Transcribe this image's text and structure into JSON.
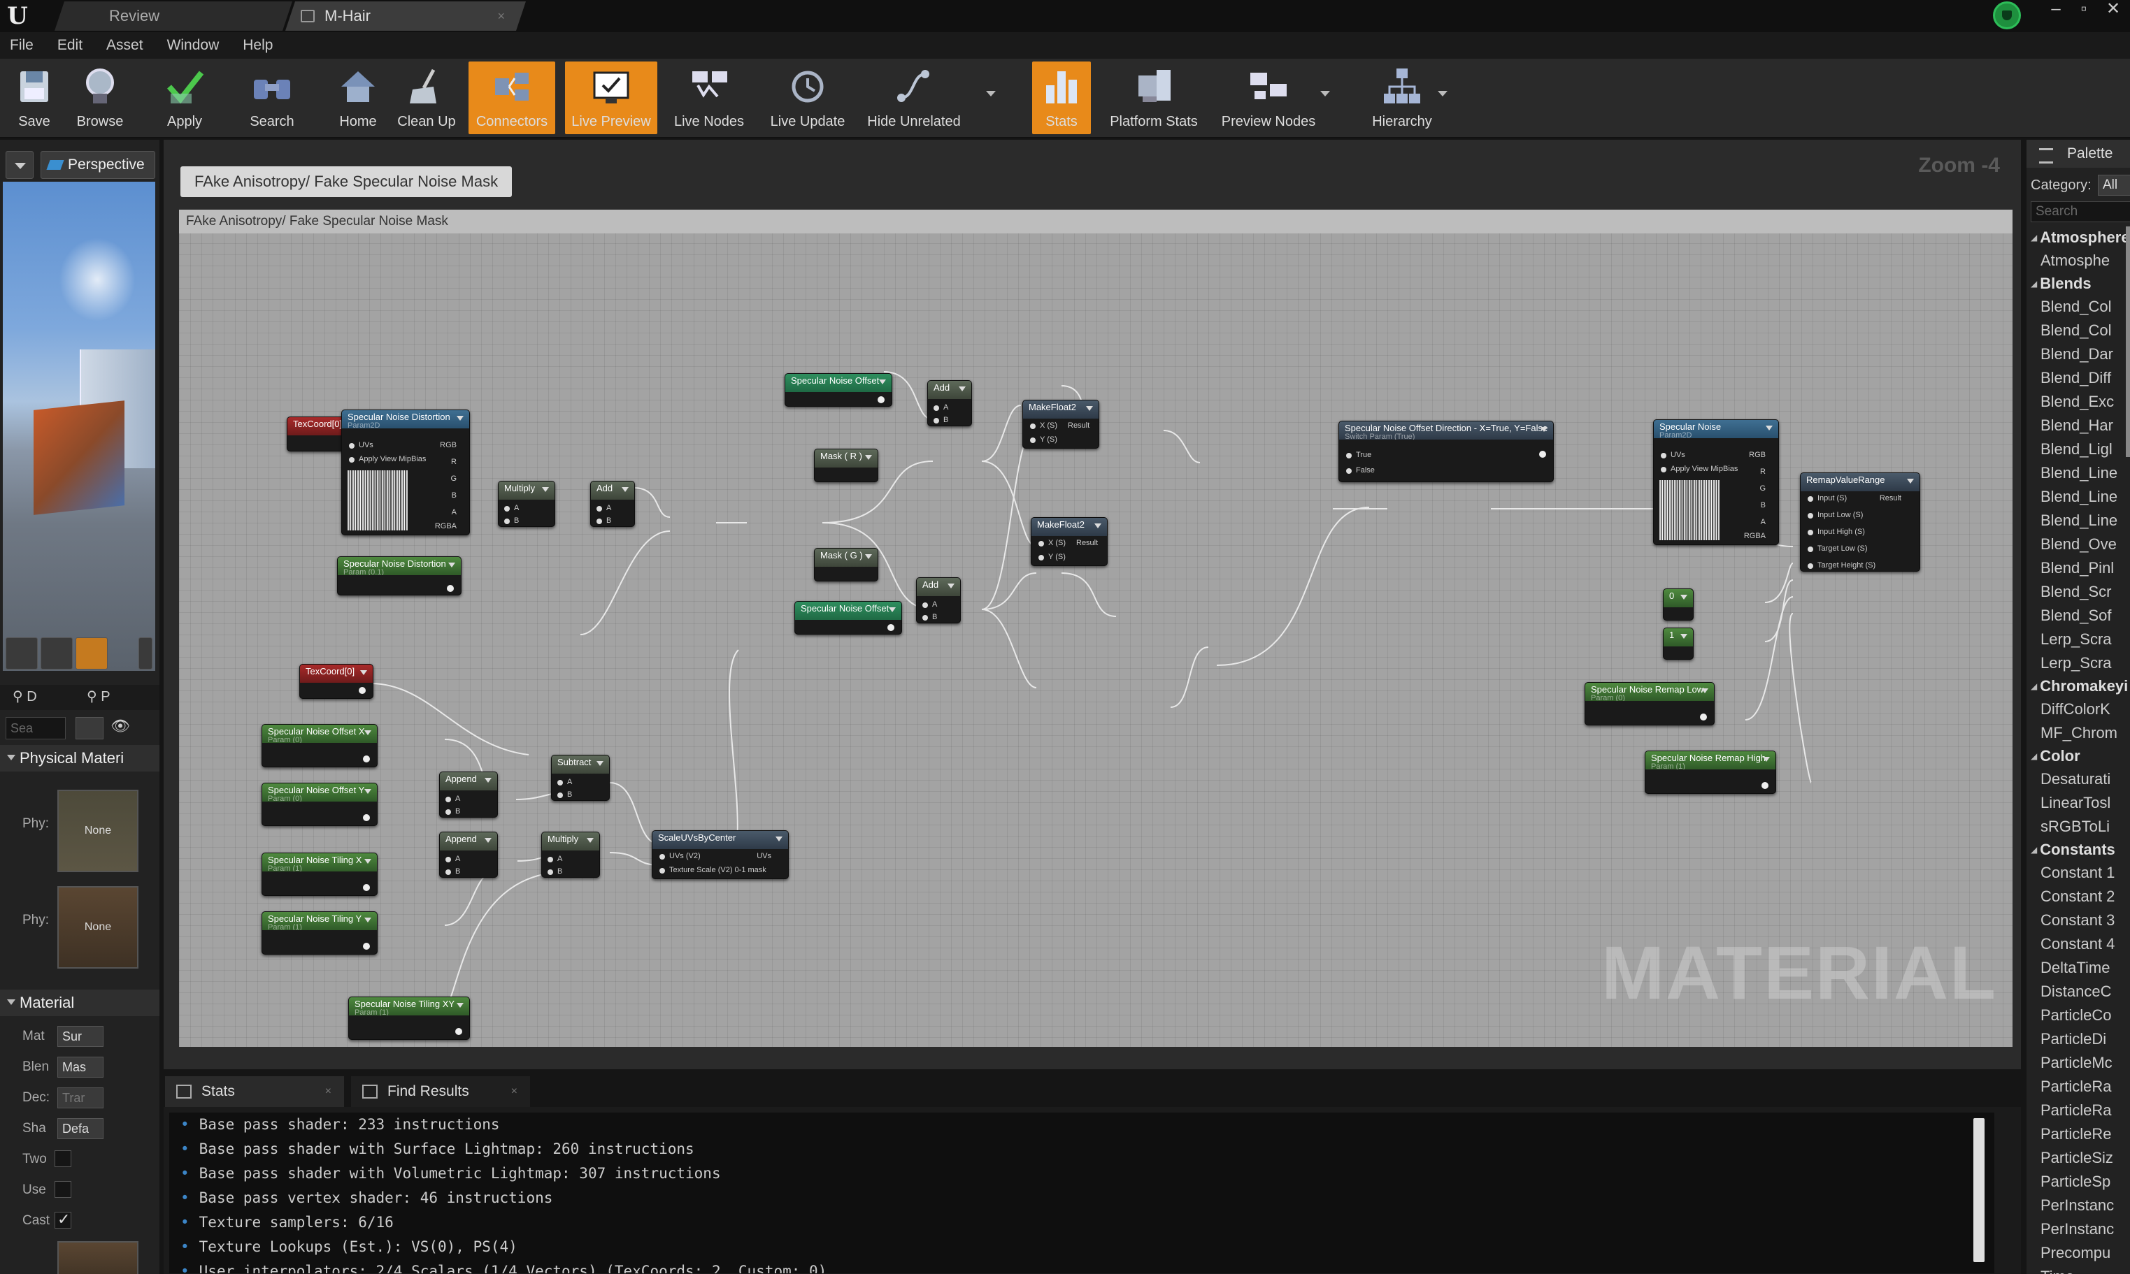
{
  "titlebar": {
    "tabs": [
      {
        "label": "Review"
      },
      {
        "label": "M-Hair"
      }
    ],
    "close_glyph": "×"
  },
  "menu": [
    "File",
    "Edit",
    "Asset",
    "Window",
    "Help"
  ],
  "toolbar": {
    "buttons": [
      {
        "label": "Save",
        "icon": "save-icon"
      },
      {
        "label": "Browse",
        "icon": "browse-icon"
      },
      {
        "label": "Apply",
        "icon": "apply-icon"
      },
      {
        "label": "Search",
        "icon": "search-icon"
      },
      {
        "label": "Home",
        "icon": "home-icon"
      },
      {
        "label": "Clean Up",
        "icon": "cleanup-icon"
      },
      {
        "label": "Connectors",
        "icon": "connectors-icon",
        "active": true
      },
      {
        "label": "Live Preview",
        "icon": "live-preview-icon",
        "active": true
      },
      {
        "label": "Live Nodes",
        "icon": "live-nodes-icon"
      },
      {
        "label": "Live Update",
        "icon": "live-update-icon"
      },
      {
        "label": "Hide Unrelated",
        "icon": "hide-unrelated-icon"
      },
      {
        "label": "Stats",
        "icon": "stats-icon",
        "active": true
      },
      {
        "label": "Platform Stats",
        "icon": "platform-stats-icon"
      },
      {
        "label": "Preview Nodes",
        "icon": "preview-nodes-icon"
      },
      {
        "label": "Hierarchy",
        "icon": "hierarchy-icon"
      }
    ]
  },
  "viewport": {
    "mode": "Perspective",
    "axis": "Z"
  },
  "details": {
    "tabs": [
      "D",
      "P"
    ],
    "search_placeholder": "Sea",
    "sections": {
      "physical": "Physical Materi",
      "material": "Material"
    },
    "phys_rows": [
      {
        "label": "Phy:",
        "value": "None"
      },
      {
        "label": "Phy:",
        "value": "None"
      }
    ],
    "material_rows": [
      {
        "label": "Mat",
        "combo": "Sur"
      },
      {
        "label": "Blen",
        "combo": "Mas"
      },
      {
        "label": "Dec:",
        "combo": "Trar"
      },
      {
        "label": "Sha",
        "combo": "Defa"
      }
    ],
    "check_rows": [
      {
        "label": "Two",
        "checked": false
      },
      {
        "label": "Use",
        "checked": false
      },
      {
        "label": "Cast",
        "checked": true
      }
    ]
  },
  "graph": {
    "title": "FAke Anisotropy/ Fake Specular Noise Mask",
    "comment": "FAke Anisotropy/ Fake Specular Noise Mask",
    "zoom": "Zoom -4",
    "watermark": "MATERIAL",
    "nodes": {
      "texcoord1": {
        "title": "TexCoord[0]"
      },
      "noise_dist": {
        "title": "Specular Noise Distortion",
        "sub": "Param2D",
        "pins": [
          "UVs",
          "Apply View MipBias"
        ],
        "outs": [
          "RGB",
          "R",
          "G",
          "B",
          "A",
          "RGBA"
        ]
      },
      "noise_dist_param": {
        "title": "Specular Noise Distortion",
        "sub": "Param (0.1)"
      },
      "multiply1": {
        "title": "Multiply",
        "pins": [
          "A",
          "B"
        ]
      },
      "add1": {
        "title": "Add",
        "pins": [
          "A",
          "B"
        ]
      },
      "noise_offset1": {
        "title": "Specular Noise Offset"
      },
      "mask_r": {
        "title": "Mask ( R )"
      },
      "mask_g": {
        "title": "Mask ( G )"
      },
      "add2": {
        "title": "Add",
        "pins": [
          "A",
          "B"
        ]
      },
      "add3": {
        "title": "Add",
        "pins": [
          "A",
          "B"
        ]
      },
      "noise_offset2": {
        "title": "Specular Noise Offset"
      },
      "makefloat1": {
        "title": "MakeFloat2",
        "pins": [
          "X (S)",
          "Y (S)"
        ],
        "out": "Result"
      },
      "makefloat2": {
        "title": "MakeFloat2",
        "pins": [
          "X (S)",
          "Y (S)"
        ],
        "out": "Result"
      },
      "switch": {
        "title": "Specular Noise Offset Direction - X=True, Y=False",
        "sub": "Switch Param (True)",
        "pins": [
          "True",
          "False"
        ]
      },
      "noise2": {
        "title": "Specular Noise",
        "sub": "Param2D",
        "pins": [
          "UVs",
          "Apply View MipBias"
        ],
        "outs": [
          "RGB",
          "R",
          "G",
          "B",
          "A",
          "RGBA"
        ]
      },
      "remap": {
        "title": "RemapValueRange",
        "pins": [
          "Input (S)",
          "Input Low (S)",
          "Input High (S)",
          "Target Low (S)",
          "Target Height (S)"
        ],
        "out": "Result"
      },
      "const0": {
        "title": "0"
      },
      "const1": {
        "title": "1"
      },
      "remap_low": {
        "title": "Specular Noise Remap Low",
        "sub": "Param (0)"
      },
      "remap_high": {
        "title": "Specular Noise Remap High",
        "sub": "Param (1)"
      },
      "texcoord2": {
        "title": "TexCoord[0]"
      },
      "offset_x": {
        "title": "Specular Noise Offset X",
        "sub": "Param (0)"
      },
      "offset_y": {
        "title": "Specular Noise Offset Y",
        "sub": "Param (0)"
      },
      "append1": {
        "title": "Append",
        "pins": [
          "A",
          "B"
        ]
      },
      "subtract": {
        "title": "Subtract",
        "pins": [
          "A",
          "B"
        ]
      },
      "scaleuv": {
        "title": "ScaleUVsByCenter",
        "pins": [
          "UVs (V2)",
          "Texture Scale (V2) 0-1 mask"
        ],
        "out": "UVs"
      },
      "tiling_x": {
        "title": "Specular Noise Tiling X",
        "sub": "Param (1)"
      },
      "tiling_y": {
        "title": "Specular Noise Tiling Y",
        "sub": "Param (1)"
      },
      "append2": {
        "title": "Append",
        "pins": [
          "A",
          "B"
        ]
      },
      "multiply2": {
        "title": "Multiply",
        "pins": [
          "A",
          "B"
        ]
      },
      "tiling_xy": {
        "title": "Specular Noise Tiling XY",
        "sub": "Param (1)"
      }
    }
  },
  "stats": {
    "tabs": [
      "Stats",
      "Find Results"
    ],
    "lines": [
      "Base pass shader: 233 instructions",
      "Base pass shader with Surface Lightmap: 260 instructions",
      "Base pass shader with Volumetric Lightmap: 307 instructions",
      "Base pass vertex shader: 46 instructions",
      "Texture samplers: 6/16",
      "Texture Lookups (Est.): VS(0), PS(4)",
      "User interpolators: 2/4 Scalars (1/4 Vectors) (TexCoords: 2, Custom: 0)"
    ]
  },
  "palette": {
    "tab": "Palette",
    "category_label": "Category:",
    "category_value": "All",
    "search_placeholder": "Search",
    "items": [
      {
        "t": "h",
        "v": "Atmosphere"
      },
      {
        "t": "i",
        "v": "Atmosphe"
      },
      {
        "t": "h",
        "v": "Blends"
      },
      {
        "t": "i",
        "v": "Blend_Col"
      },
      {
        "t": "i",
        "v": "Blend_Col"
      },
      {
        "t": "i",
        "v": "Blend_Dar"
      },
      {
        "t": "i",
        "v": "Blend_Diff"
      },
      {
        "t": "i",
        "v": "Blend_Exc"
      },
      {
        "t": "i",
        "v": "Blend_Har"
      },
      {
        "t": "i",
        "v": "Blend_Ligl"
      },
      {
        "t": "i",
        "v": "Blend_Line"
      },
      {
        "t": "i",
        "v": "Blend_Line"
      },
      {
        "t": "i",
        "v": "Blend_Line"
      },
      {
        "t": "i",
        "v": "Blend_Ove"
      },
      {
        "t": "i",
        "v": "Blend_Pinl"
      },
      {
        "t": "i",
        "v": "Blend_Scr"
      },
      {
        "t": "i",
        "v": "Blend_Sof"
      },
      {
        "t": "i",
        "v": "Lerp_Scra"
      },
      {
        "t": "i",
        "v": "Lerp_Scra"
      },
      {
        "t": "h",
        "v": "Chromakeyi"
      },
      {
        "t": "i",
        "v": "DiffColorK"
      },
      {
        "t": "i",
        "v": "MF_Chrom"
      },
      {
        "t": "h",
        "v": "Color"
      },
      {
        "t": "i",
        "v": "Desaturati"
      },
      {
        "t": "i",
        "v": "LinearTosl"
      },
      {
        "t": "i",
        "v": "sRGBToLi"
      },
      {
        "t": "h",
        "v": "Constants"
      },
      {
        "t": "i",
        "v": "Constant 1"
      },
      {
        "t": "i",
        "v": "Constant 2"
      },
      {
        "t": "i",
        "v": "Constant 3"
      },
      {
        "t": "i",
        "v": "Constant 4"
      },
      {
        "t": "i",
        "v": "DeltaTime"
      },
      {
        "t": "i",
        "v": "DistanceC"
      },
      {
        "t": "i",
        "v": "ParticleCo"
      },
      {
        "t": "i",
        "v": "ParticleDi"
      },
      {
        "t": "i",
        "v": "ParticleMc"
      },
      {
        "t": "i",
        "v": "ParticleRa"
      },
      {
        "t": "i",
        "v": "ParticleRa"
      },
      {
        "t": "i",
        "v": "ParticleRe"
      },
      {
        "t": "i",
        "v": "ParticleSiz"
      },
      {
        "t": "i",
        "v": "ParticleSp"
      },
      {
        "t": "i",
        "v": "PerInstanc"
      },
      {
        "t": "i",
        "v": "PerInstanc"
      },
      {
        "t": "i",
        "v": "Precompu"
      },
      {
        "t": "i",
        "v": "Time"
      }
    ]
  }
}
